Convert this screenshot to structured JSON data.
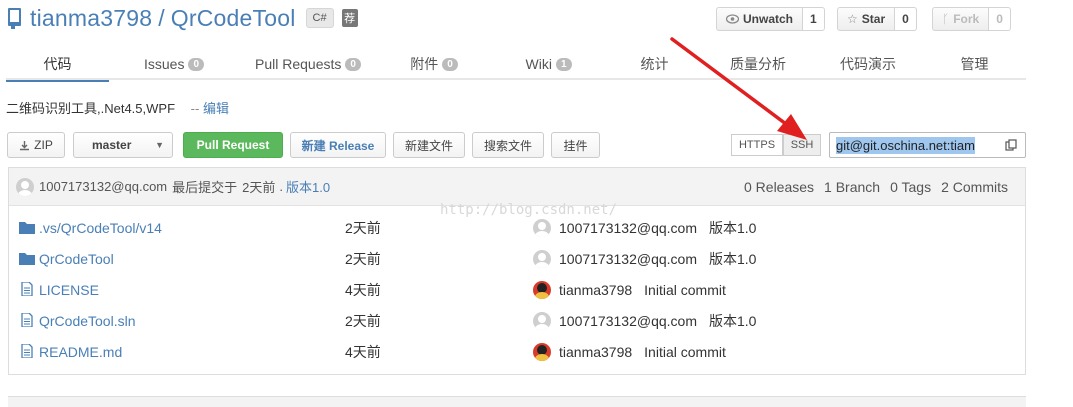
{
  "header": {
    "owner": "tianma3798",
    "separator": "/",
    "repo": "QrCodeTool",
    "language": "C#",
    "recommend_label": "荐"
  },
  "social": {
    "watch": {
      "label": "Unwatch",
      "count": "1"
    },
    "star": {
      "label": "Star",
      "count": "0"
    },
    "fork": {
      "label": "Fork",
      "count": "0"
    }
  },
  "tabs": [
    {
      "label": "代码"
    },
    {
      "label": "Issues",
      "badge": "0"
    },
    {
      "label": "Pull Requests",
      "badge": "0"
    },
    {
      "label": "附件",
      "badge": "0"
    },
    {
      "label": "Wiki",
      "badge": "1"
    },
    {
      "label": "统计"
    },
    {
      "label": "质量分析"
    },
    {
      "label": "代码演示"
    },
    {
      "label": "管理"
    }
  ],
  "description": {
    "text": "二维码识别工具,.Net4.5,WPF",
    "dash": "--",
    "edit": "编辑"
  },
  "toolbar": {
    "zip": "ZIP",
    "branch": "master",
    "pull_request": "Pull Request",
    "new_release": "新建 Release",
    "new_file": "新建文件",
    "search_file": "搜索文件",
    "attach": "挂件",
    "https": "HTTPS",
    "ssh": "SSH",
    "clone_url": "git@git.oschina.net:tiam"
  },
  "commit": {
    "author": "1007173132@qq.com",
    "prefix": "最后提交于",
    "time": "2天前",
    "dot": ".",
    "message": "版本1.0",
    "releases": "0 Releases",
    "branch": "1 Branch",
    "tags": "0 Tags",
    "commits": "2 Commits"
  },
  "files": [
    {
      "type": "folder",
      "name": ".vs/QrCodeTool/",
      "name_link": "v14",
      "time": "2天前",
      "author": "1007173132@qq.com",
      "avatar": "default",
      "message": "版本1.0"
    },
    {
      "type": "folder",
      "name": "QrCodeTool",
      "name_link": "",
      "time": "2天前",
      "author": "1007173132@qq.com",
      "avatar": "default",
      "message": "版本1.0"
    },
    {
      "type": "file",
      "name": "LICENSE",
      "name_link": "",
      "time": "4天前",
      "author": "tianma3798",
      "avatar": "mickey",
      "message": "Initial commit"
    },
    {
      "type": "file",
      "name": "QrCodeTool.sln",
      "name_link": "",
      "time": "2天前",
      "author": "1007173132@qq.com",
      "avatar": "default",
      "message": "版本1.0"
    },
    {
      "type": "file",
      "name": "README.md",
      "name_link": "",
      "time": "4天前",
      "author": "tianma3798",
      "avatar": "mickey",
      "message": "Initial commit"
    }
  ],
  "watermark": "http://blog.csdn.net/",
  "colors": {
    "link": "#4a7fb6",
    "green": "#5cb85c",
    "arrow": "#e02020",
    "selection": "#9ec6ee"
  }
}
